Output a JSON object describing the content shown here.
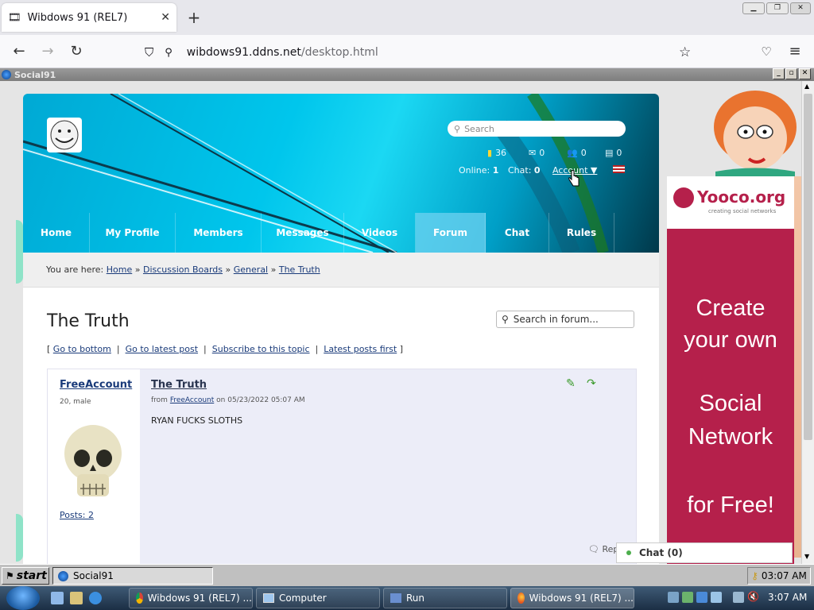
{
  "browser": {
    "tab_title": "Wibdows 91 (REL7)",
    "url_host": "wibdows91.ddns.net",
    "url_path": "/desktop.html"
  },
  "inner_window": {
    "title": "Social91"
  },
  "site": {
    "search_placeholder": "Search",
    "stats": {
      "coins": "36",
      "messages": "0",
      "friends": "0",
      "notes": "0"
    },
    "online_label": "Online:",
    "online_value": "1",
    "chat_label": "Chat:",
    "chat_value": "0",
    "account_label": "Account ▼",
    "nav": [
      "Home",
      "My Profile",
      "Members",
      "Messages",
      "Videos",
      "Forum",
      "Chat",
      "Rules"
    ],
    "breadcrumb_prefix": "You are here:",
    "breadcrumb": [
      "Home",
      "Discussion Boards",
      "General",
      "The Truth"
    ],
    "topic_title": "The Truth",
    "forum_search_placeholder": "Search in forum...",
    "topic_actions": [
      "Go to bottom",
      "Go to latest post",
      "Subscribe to this topic",
      "Latest posts first"
    ],
    "post": {
      "author": "FreeAccount",
      "author_meta": "20, male",
      "posts_label": "Posts: 2",
      "title": "The Truth",
      "from_prefix": "from",
      "from_author": "FreeAccount",
      "from_suffix": "on 05/23/2022 05:07 AM",
      "body": "RYAN FUCKS SLOTHS",
      "reply": "Rep"
    },
    "ad": {
      "brand": "Yooco.org",
      "tagline": "creating social networks",
      "line1": "Create",
      "line2": "your own",
      "line3": "Social",
      "line4": "Network",
      "line5": "for Free!"
    },
    "chat_widget": "Chat (0)"
  },
  "w91_taskbar": {
    "start": "start",
    "task": "Social91",
    "clock": "03:07 AM"
  },
  "w7_taskbar": {
    "buttons": [
      "Wibdows 91 (REL7) ...",
      "Computer",
      "Run",
      "Wibdows 91 (REL7) ..."
    ],
    "clock": "3:07 AM"
  }
}
